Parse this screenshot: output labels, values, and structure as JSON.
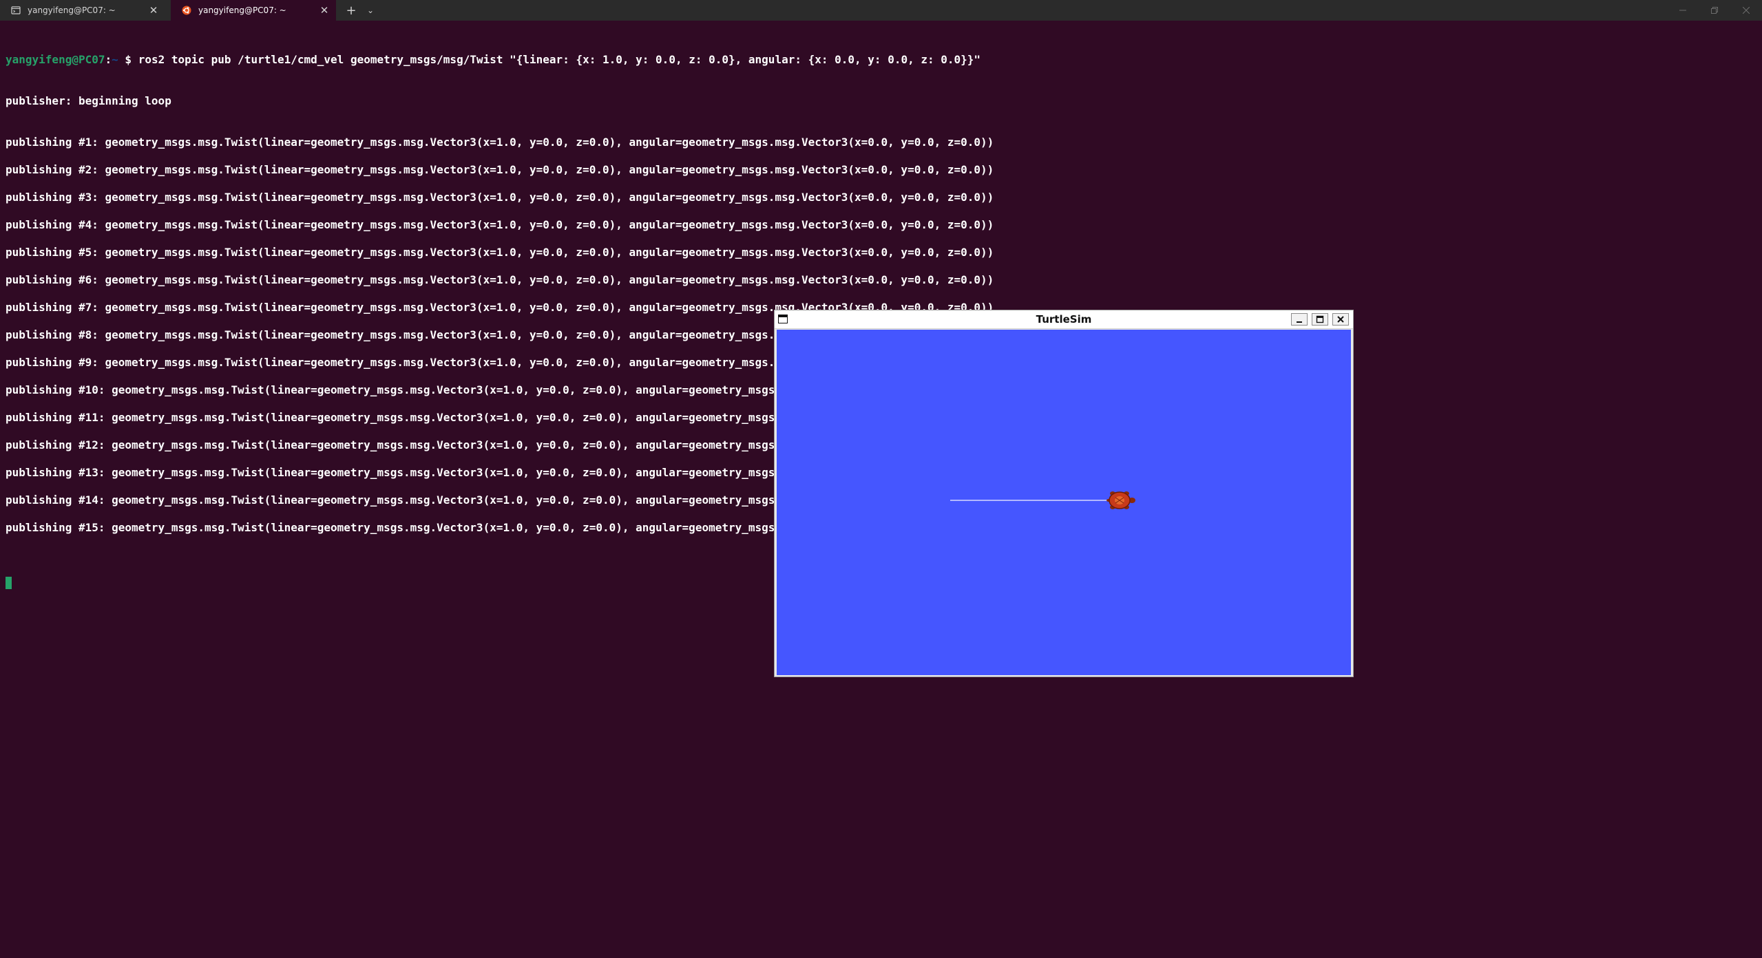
{
  "tabs": [
    {
      "title": "yangyifeng@PC07: ~",
      "icon": "terminal-icon",
      "active": false
    },
    {
      "title": "yangyifeng@PC07: ~",
      "icon": "ubuntu-icon",
      "active": true
    }
  ],
  "tabbar": {
    "new_tab": "+",
    "dropdown": "⌄",
    "close_glyph": "✕"
  },
  "terminal": {
    "prompt_user": "yangyifeng@PC07",
    "prompt_sep": ":",
    "prompt_path": "~",
    "command": "$ ros2 topic pub /turtle1/cmd_vel geometry_msgs/msg/Twist \"{linear: {x: 1.0, y: 0.0, z: 0.0}, angular: {x: 0.0, y: 0.0, z: 0.0}}\"",
    "status": "publisher: beginning loop",
    "lines": [
      "publishing #1: geometry_msgs.msg.Twist(linear=geometry_msgs.msg.Vector3(x=1.0, y=0.0, z=0.0), angular=geometry_msgs.msg.Vector3(x=0.0, y=0.0, z=0.0))",
      "publishing #2: geometry_msgs.msg.Twist(linear=geometry_msgs.msg.Vector3(x=1.0, y=0.0, z=0.0), angular=geometry_msgs.msg.Vector3(x=0.0, y=0.0, z=0.0))",
      "publishing #3: geometry_msgs.msg.Twist(linear=geometry_msgs.msg.Vector3(x=1.0, y=0.0, z=0.0), angular=geometry_msgs.msg.Vector3(x=0.0, y=0.0, z=0.0))",
      "publishing #4: geometry_msgs.msg.Twist(linear=geometry_msgs.msg.Vector3(x=1.0, y=0.0, z=0.0), angular=geometry_msgs.msg.Vector3(x=0.0, y=0.0, z=0.0))",
      "publishing #5: geometry_msgs.msg.Twist(linear=geometry_msgs.msg.Vector3(x=1.0, y=0.0, z=0.0), angular=geometry_msgs.msg.Vector3(x=0.0, y=0.0, z=0.0))",
      "publishing #6: geometry_msgs.msg.Twist(linear=geometry_msgs.msg.Vector3(x=1.0, y=0.0, z=0.0), angular=geometry_msgs.msg.Vector3(x=0.0, y=0.0, z=0.0))",
      "publishing #7: geometry_msgs.msg.Twist(linear=geometry_msgs.msg.Vector3(x=1.0, y=0.0, z=0.0), angular=geometry_msgs.msg.Vector3(x=0.0, y=0.0, z=0.0))",
      "publishing #8: geometry_msgs.msg.Twist(linear=geometry_msgs.msg.Vector3(x=1.0, y=0.0, z=0.0), angular=geometry_msgs.msg.Vector3(x=0.0, y=0.0, z=0.0))",
      "publishing #9: geometry_msgs.msg.Twist(linear=geometry_msgs.msg.Vector3(x=1.0, y=0.0, z=0.0), angular=geometry_msgs.msg.Vector3(x=0.0, y=0.0, z=0.0))",
      "publishing #10: geometry_msgs.msg.Twist(linear=geometry_msgs.msg.Vector3(x=1.0, y=0.0, z=0.0), angular=geometry_msgs.msg.Vector3(x=0.0, y=0.0, z=0.0))",
      "publishing #11: geometry_msgs.msg.Twist(linear=geometry_msgs.msg.Vector3(x=1.0, y=0.0, z=0.0), angular=geometry_msgs.msg.Vector3(x=0.0, y=0.0, z=0.0))",
      "publishing #12: geometry_msgs.msg.Twist(linear=geometry_msgs.msg.Vector3(x=1.0, y=0.0, z=0.0), angular=geometry_msgs.msg.Vector3(x=0.0, y=0.0, z=0.0))",
      "publishing #13: geometry_msgs.msg.Twist(linear=geometry_msgs.msg.Vector3(x=1.0, y=0.0, z=0.0), angular=geometry_msgs.msg.Vector3(x=0.0, y=0.0, z=0.0))",
      "publishing #14: geometry_msgs.msg.Twist(linear=geometry_msgs.msg.Vector3(x=1.0, y=0.0, z=0.0), angular=geometry_msgs.msg.Vector3(x=0.0, y=0.0, z=0.0))",
      "publishing #15: geometry_msgs.msg.Twist(linear=geometry_msgs.msg.Vector3(x=1.0, y=0.0, z=0.0), angular=geometry_msgs.msg.Vector3(x=0.0, y=0.0, z=0.0))"
    ]
  },
  "turtlesim": {
    "title": "TurtleSim",
    "background_color": "#4556ff",
    "pen_color": "#b3b8ff"
  },
  "colors": {
    "terminal_bg": "#300a24",
    "prompt_user": "#26a269",
    "prompt_path": "#12488b"
  }
}
